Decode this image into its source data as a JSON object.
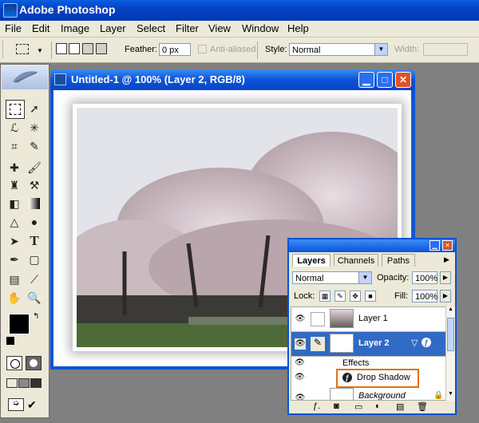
{
  "app": {
    "title": "Adobe Photoshop"
  },
  "menu": [
    "File",
    "Edit",
    "Image",
    "Layer",
    "Select",
    "Filter",
    "View",
    "Window",
    "Help"
  ],
  "options": {
    "feather_label": "Feather:",
    "feather_value": "0 px",
    "antialiased_label": "Anti-aliased",
    "style_label": "Style:",
    "style_value": "Normal",
    "width_label": "Width:"
  },
  "document": {
    "title": "Untitled-1 @ 100% (Layer 2, RGB/8)"
  },
  "layers_panel": {
    "tabs": [
      "Layers",
      "Channels",
      "Paths"
    ],
    "blend_mode": "Normal",
    "opacity_label": "Opacity:",
    "opacity_value": "100%",
    "lock_label": "Lock:",
    "fill_label": "Fill:",
    "fill_value": "100%",
    "layers": [
      {
        "name": "Layer 1",
        "selected": false
      },
      {
        "name": "Layer 2",
        "selected": true
      },
      {
        "name": "Effects",
        "selected": false
      },
      {
        "name": "Drop Shadow",
        "selected": false
      },
      {
        "name": "Background",
        "selected": false
      }
    ]
  },
  "colors": {
    "xp_blue": "#0a53d8",
    "selection": "#316ac5",
    "highlight_box": "#e0711c"
  }
}
